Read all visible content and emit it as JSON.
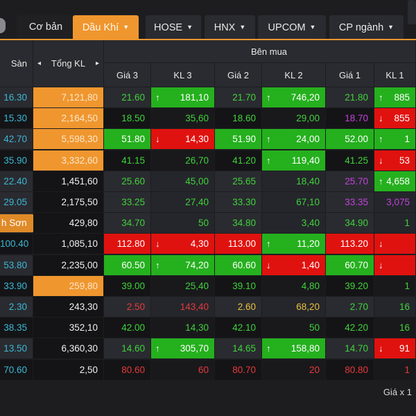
{
  "tabs": [
    {
      "label": "Cơ bản",
      "caret": false,
      "active": false
    },
    {
      "label": "Dầu Khí",
      "caret": true,
      "active": true
    },
    {
      "label": "HOSE",
      "caret": true,
      "active": false
    },
    {
      "label": "HNX",
      "caret": true,
      "active": false
    },
    {
      "label": "UPCOM",
      "caret": true,
      "active": false
    },
    {
      "label": "CP ngành",
      "caret": true,
      "active": false
    }
  ],
  "header": {
    "san": "Sàn",
    "tong_kl": "Tổng KL",
    "left_arrow": "◂",
    "right_arrow": "▸",
    "ben_mua": "Bên mua",
    "cols": [
      "Giá 3",
      "KL 3",
      "Giá 2",
      "KL 2",
      "Giá 1",
      "KL 1"
    ]
  },
  "colors": {
    "green": "#3fd33a",
    "cyan": "#3bb8d6",
    "purple": "#c442dc",
    "red": "#e53a3a",
    "yellow": "#e9c23e",
    "white": "#e6e6e6",
    "bg_green": "#25b01e",
    "bg_red": "#e0120f",
    "orange": "#f0962e"
  },
  "rows": [
    {
      "san": "16.30",
      "tkl": "7,121,80",
      "orange": true,
      "light": true,
      "cells": [
        [
          "21.60",
          "g"
        ],
        [
          "181,10",
          "w",
          "G",
          "up"
        ],
        [
          "21.70",
          "g"
        ],
        [
          "746,20",
          "w",
          "G",
          "up"
        ],
        [
          "21.80",
          "g"
        ],
        [
          "885",
          "w",
          "G",
          "up"
        ]
      ]
    },
    {
      "san": "15.30",
      "tkl": "2,164,50",
      "orange": true,
      "light": false,
      "cells": [
        [
          "18.50",
          "g"
        ],
        [
          "35,60",
          "g"
        ],
        [
          "18.60",
          "g"
        ],
        [
          "29,00",
          "g"
        ],
        [
          "18.70",
          "p"
        ],
        [
          "855",
          "w",
          "R",
          "down"
        ]
      ]
    },
    {
      "san": "42.70",
      "tkl": "5,598,30",
      "orange": true,
      "light": true,
      "cells": [
        [
          "51.80",
          "w",
          "G"
        ],
        [
          "14,30",
          "w",
          "R",
          "down"
        ],
        [
          "51.90",
          "w",
          "G"
        ],
        [
          "24,00",
          "w",
          "G",
          "up"
        ],
        [
          "52.00",
          "w",
          "G"
        ],
        [
          "1",
          "w",
          "G",
          "up"
        ]
      ]
    },
    {
      "san": "35.90",
      "tkl": "3,332,60",
      "orange": true,
      "light": false,
      "cells": [
        [
          "41.15",
          "g"
        ],
        [
          "26,70",
          "g"
        ],
        [
          "41.20",
          "g"
        ],
        [
          "119,40",
          "w",
          "G",
          "up"
        ],
        [
          "41.25",
          "g"
        ],
        [
          "53",
          "w",
          "R",
          "down"
        ]
      ]
    },
    {
      "san": "22.40",
      "tkl": "1,451,60",
      "orange": false,
      "light": true,
      "cells": [
        [
          "25.60",
          "g"
        ],
        [
          "45,00",
          "g"
        ],
        [
          "25.65",
          "g"
        ],
        [
          "18,40",
          "g"
        ],
        [
          "25.70",
          "p"
        ],
        [
          "4,658",
          "w",
          "G",
          "up"
        ]
      ]
    },
    {
      "san": "29.05",
      "tkl": "2,175,50",
      "orange": false,
      "light": true,
      "cells": [
        [
          "33.25",
          "g"
        ],
        [
          "27,40",
          "g"
        ],
        [
          "33.30",
          "g"
        ],
        [
          "67,10",
          "g"
        ],
        [
          "33.35",
          "p"
        ],
        [
          "3,075",
          "p"
        ]
      ]
    },
    {
      "san": "h Sơn",
      "badge": true,
      "tkl": "429,80",
      "orange": false,
      "light": true,
      "cells": [
        [
          "34.70",
          "g"
        ],
        [
          "50",
          "g"
        ],
        [
          "34.80",
          "g"
        ],
        [
          "3,40",
          "g"
        ],
        [
          "34.90",
          "g"
        ],
        [
          "1",
          "g"
        ]
      ]
    },
    {
      "san": "100.40",
      "tkl": "1,085,10",
      "orange": false,
      "light": false,
      "cells": [
        [
          "112.80",
          "w",
          "R"
        ],
        [
          "4,30",
          "w",
          "R",
          "down"
        ],
        [
          "113.00",
          "w",
          "R"
        ],
        [
          "11,20",
          "w",
          "G",
          "up"
        ],
        [
          "113.20",
          "w",
          "R"
        ],
        [
          "",
          "w",
          "R",
          "down"
        ]
      ]
    },
    {
      "san": "53.80",
      "tkl": "2,235,00",
      "orange": false,
      "light": true,
      "cells": [
        [
          "60.50",
          "w",
          "G"
        ],
        [
          "74,20",
          "w",
          "G",
          "up"
        ],
        [
          "60.60",
          "w",
          "G"
        ],
        [
          "1,40",
          "w",
          "R",
          "down"
        ],
        [
          "60.70",
          "w",
          "G"
        ],
        [
          "",
          "w",
          "R",
          "down"
        ]
      ]
    },
    {
      "san": "33.90",
      "tkl": "259,80",
      "orange": true,
      "light": false,
      "cells": [
        [
          "39.00",
          "g"
        ],
        [
          "25,40",
          "g"
        ],
        [
          "39.10",
          "g"
        ],
        [
          "4,80",
          "g"
        ],
        [
          "39.20",
          "g"
        ],
        [
          "1",
          "g"
        ]
      ]
    },
    {
      "san": "2.30",
      "tkl": "243,30",
      "orange": false,
      "light": true,
      "cells": [
        [
          "2.50",
          "r"
        ],
        [
          "143,40",
          "r"
        ],
        [
          "2.60",
          "y"
        ],
        [
          "68,20",
          "y"
        ],
        [
          "2.70",
          "g"
        ],
        [
          "16",
          "g"
        ]
      ]
    },
    {
      "san": "38.35",
      "tkl": "352,10",
      "orange": false,
      "light": false,
      "cells": [
        [
          "42.00",
          "g"
        ],
        [
          "14,30",
          "g"
        ],
        [
          "42.10",
          "g"
        ],
        [
          "50",
          "g"
        ],
        [
          "42.20",
          "g"
        ],
        [
          "16",
          "g"
        ]
      ]
    },
    {
      "san": "13.50",
      "tkl": "6,360,30",
      "orange": false,
      "light": true,
      "cells": [
        [
          "14.60",
          "g"
        ],
        [
          "305,70",
          "w",
          "G",
          "up"
        ],
        [
          "14.65",
          "g"
        ],
        [
          "158,80",
          "w",
          "G",
          "up"
        ],
        [
          "14.70",
          "g"
        ],
        [
          "91",
          "w",
          "R",
          "down"
        ]
      ]
    },
    {
      "san": "70.60",
      "tkl": "2,50",
      "orange": false,
      "light": false,
      "cells": [
        [
          "80.60",
          "r"
        ],
        [
          "60",
          "r"
        ],
        [
          "80.70",
          "r"
        ],
        [
          "20",
          "r"
        ],
        [
          "80.80",
          "r"
        ],
        [
          "1",
          "r"
        ]
      ]
    }
  ],
  "footer": "Giá x 1",
  "icons": {
    "up": "↑",
    "down": "↓",
    "caret": "▼"
  }
}
